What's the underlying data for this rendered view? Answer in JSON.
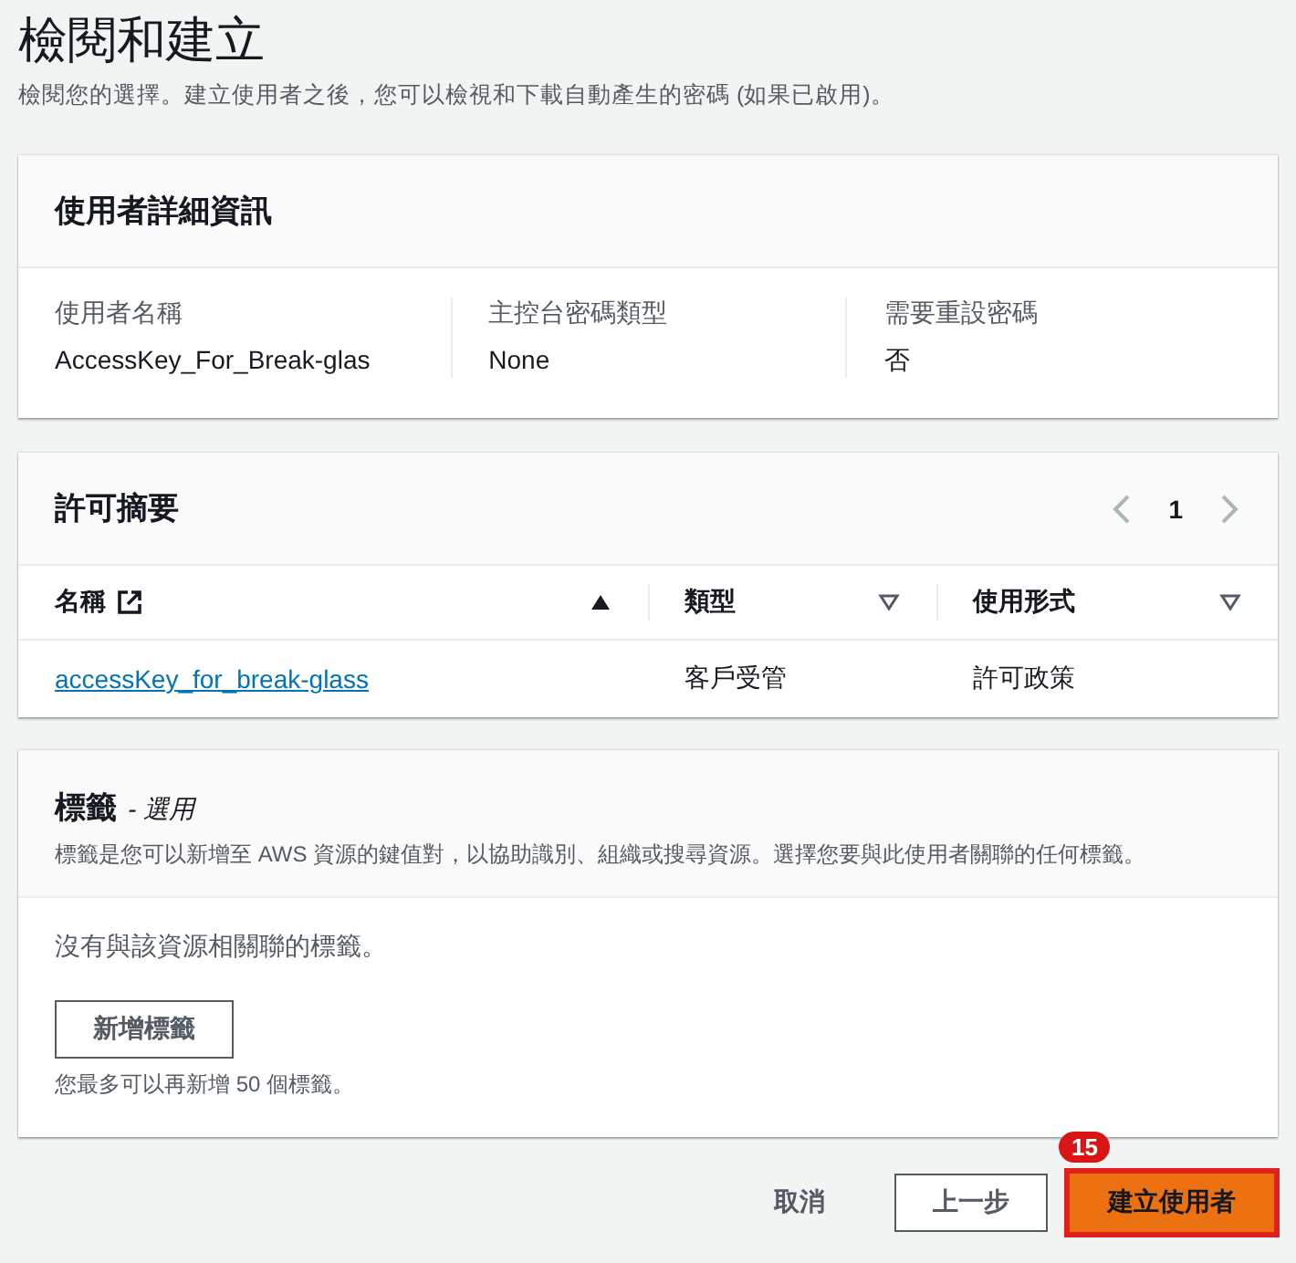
{
  "page": {
    "title": "檢閱和建立",
    "description": "檢閱您的選擇。建立使用者之後，您可以檢視和下載自動產生的密碼 (如果已啟用)。"
  },
  "user_details": {
    "title": "使用者詳細資訊",
    "fields": [
      {
        "label": "使用者名稱",
        "value": "AccessKey_For_Break-glas"
      },
      {
        "label": "主控台密碼類型",
        "value": "None"
      },
      {
        "label": "需要重設密碼",
        "value": "否"
      }
    ]
  },
  "permissions": {
    "title": "許可摘要",
    "pagination": {
      "pages": [
        {
          "label": "1",
          "selected": true
        }
      ],
      "prev_disabled": true,
      "next_disabled": true
    },
    "columns": [
      {
        "label": "名稱",
        "external_link": true,
        "sorted": true
      },
      {
        "label": "類型",
        "external_link": false,
        "sorted": false
      },
      {
        "label": "使用形式",
        "external_link": false,
        "sorted": false
      }
    ],
    "rows": [
      {
        "name": "accessKey_for_break-glass",
        "type": "客戶受管",
        "usage": "許可政策"
      }
    ]
  },
  "tags": {
    "title": "標籤",
    "optional": "- 選用",
    "description": "標籤是您可以新增至 AWS 資源的鍵值對，以協助識別、組織或搜尋資源。選擇您要與此使用者關聯的任何標籤。",
    "empty_text": "沒有與該資源相關聯的標籤。",
    "add_button": "新增標籤",
    "limit_text": "您最多可以再新增 50 個標籤。"
  },
  "actions": [
    {
      "label": "取消",
      "kind": "link",
      "highlighted": false
    },
    {
      "label": "上一步",
      "kind": "normal",
      "highlighted": false
    },
    {
      "label": "建立使用者",
      "kind": "primary",
      "highlighted": true,
      "badge": "15"
    }
  ]
}
